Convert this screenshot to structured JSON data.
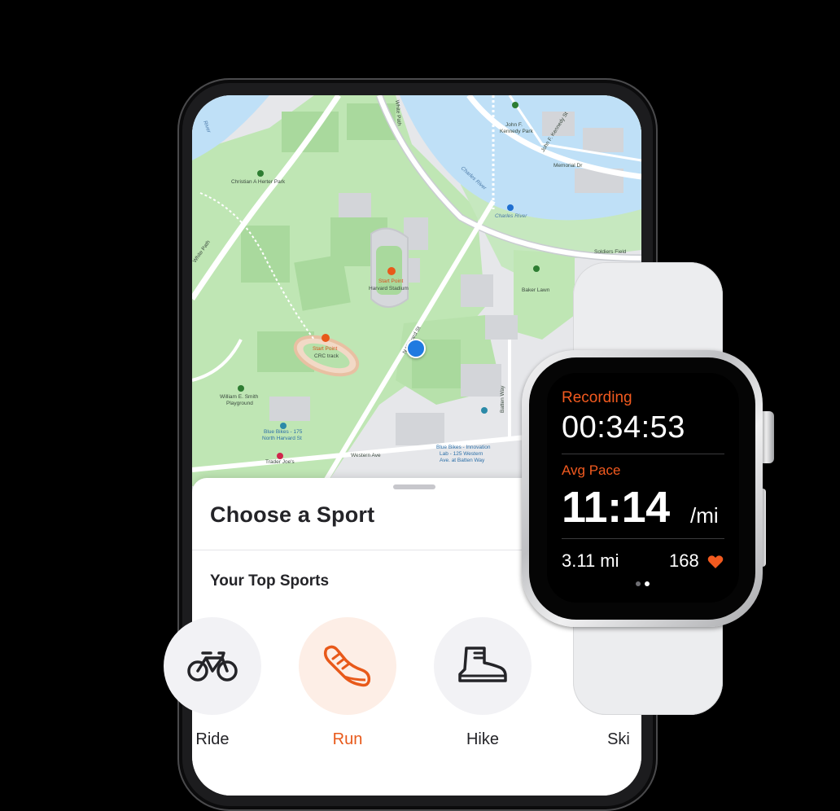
{
  "map": {
    "labels": {
      "charles_river_north": "Charles River",
      "charles_river_station": "Charles River",
      "herter_park": "Christian A Herter Park",
      "kennedy_park_line1": "John F.",
      "kennedy_park_line2": "Kennedy Park",
      "jfk_street": "John F. Kennedy St",
      "memorial_dr": "Memorial Dr",
      "soldiers_field": "Soldiers Field",
      "white_path_top": "White Path",
      "white_path_left": "White Path",
      "stadium_start": "Start Point",
      "stadium_name": "Harvard Stadium",
      "crc_start": "Start Point",
      "crc_name": "CRC track",
      "baker_lawn": "Baker Lawn",
      "n_harvard_st": "N Harvard St",
      "playground_line1": "William E. Smith",
      "playground_line2": "Playground",
      "bluebikes1_line1": "Blue Bikes - 175",
      "bluebikes1_line2": "North Harvard St",
      "bluebikes2_line1": "Blue Bikes - Innovation",
      "bluebikes2_line2": "Lab - 125 Western",
      "bluebikes2_line3": "Ave. at Batten Way",
      "western_ave": "Western Ave",
      "batten_way": "Batten Way",
      "trader_joes": "Trader Joe's",
      "river_left": "River"
    }
  },
  "sheet": {
    "title": "Choose a Sport",
    "section_title": "Your Top Sports"
  },
  "sports": [
    {
      "label": "Ride",
      "icon": "bike-icon",
      "active": false
    },
    {
      "label": "Run",
      "icon": "running-shoe-icon",
      "active": true
    },
    {
      "label": "Hike",
      "icon": "hiking-boot-icon",
      "active": false
    },
    {
      "label": "Ski",
      "icon": "ski-icon",
      "active": false
    }
  ],
  "watch": {
    "recording_label": "Recording",
    "elapsed_time": "00:34:53",
    "pace_label": "Avg Pace",
    "pace_value": "11:14",
    "pace_unit": "/mi",
    "distance": "3.11 mi",
    "heart_rate": "168",
    "heart_icon": "heart-icon",
    "page_dots": {
      "count": 2,
      "active_index": 1
    }
  },
  "colors": {
    "accent": "#F25A1F",
    "user_location": "#1F7AE0",
    "park_green": "#B9E4B0",
    "water_blue": "#BFE0F7"
  }
}
